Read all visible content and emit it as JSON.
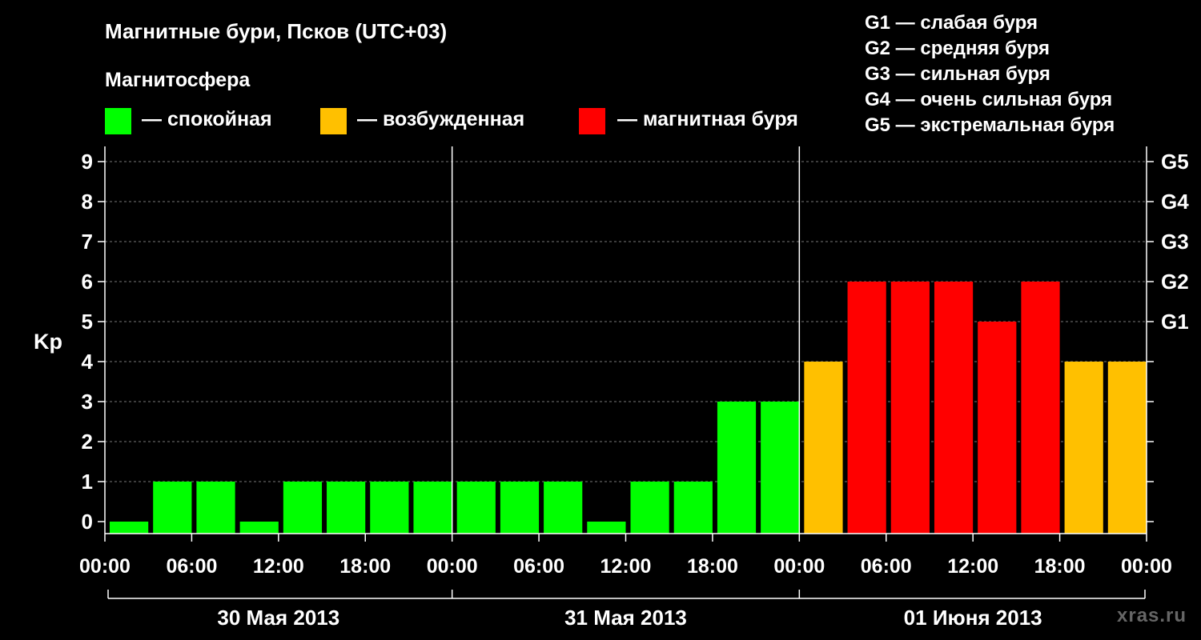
{
  "title": "Магнитные бури, Псков (UTC+03)",
  "subtitle": "Магнитосфера",
  "legend": [
    {
      "label": "— спокойная",
      "color": "#00ff00"
    },
    {
      "label": "— возбужденная",
      "color": "#ffc000"
    },
    {
      "label": "— магнитная буря",
      "color": "#ff0000"
    }
  ],
  "g_legend": [
    "G1 — слабая буря",
    "G2 — средняя буря",
    "G3 — сильная буря",
    "G4 — очень сильная буря",
    "G5 — экстремальная буря"
  ],
  "watermark": "xras.ru",
  "chart_data": {
    "type": "bar",
    "ylabel": "Kp",
    "ylim": [
      0,
      9
    ],
    "y_ticks": [
      0,
      1,
      2,
      3,
      4,
      5,
      6,
      7,
      8,
      9
    ],
    "right_ticks": [
      {
        "value": 5,
        "label": "G1"
      },
      {
        "value": 6,
        "label": "G2"
      },
      {
        "value": 7,
        "label": "G3"
      },
      {
        "value": 8,
        "label": "G4"
      },
      {
        "value": 9,
        "label": "G5"
      }
    ],
    "x_tick_labels": [
      "00:00",
      "06:00",
      "12:00",
      "18:00",
      "00:00",
      "06:00",
      "12:00",
      "18:00",
      "00:00",
      "06:00",
      "12:00",
      "18:00",
      "00:00"
    ],
    "days": [
      "30 Мая 2013",
      "31 Мая 2013",
      "01 Июня 2013"
    ],
    "interval_hours": 3,
    "values": [
      0,
      1,
      1,
      0,
      1,
      1,
      1,
      1,
      1,
      1,
      1,
      0,
      1,
      1,
      3,
      3,
      4,
      6,
      6,
      6,
      5,
      6,
      4,
      4
    ],
    "colors": {
      "quiet": "#00ff00",
      "active": "#ffc000",
      "storm": "#ff0000"
    },
    "grid": "dashed horizontal"
  }
}
